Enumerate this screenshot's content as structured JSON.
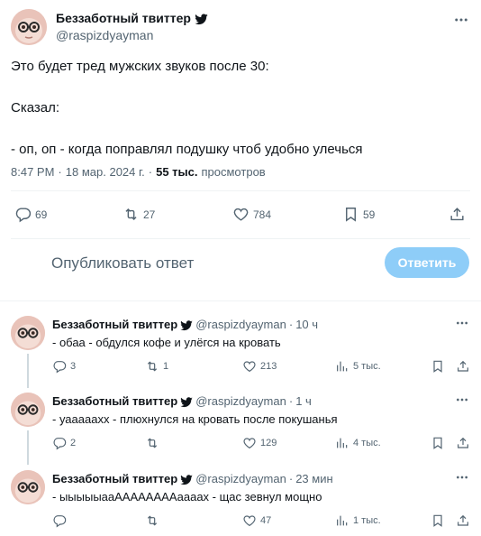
{
  "main_tweet": {
    "author_name": "Беззаботный твиттер",
    "handle": "@raspizdyayman",
    "text_lines": [
      "Это будет тред мужских звуков после 30:",
      "",
      "Сказал:",
      "",
      "- оп, оп - когда поправлял подушку чтоб удобно улечься"
    ],
    "time": "8:47 PM",
    "date": "18 мар. 2024 г.",
    "views_count": "55 тыс.",
    "views_label": "просмотров",
    "replies": "69",
    "retweets": "27",
    "likes": "784",
    "bookmarks": "59"
  },
  "composer": {
    "placeholder": "Опубликовать ответ",
    "submit_label": "Ответить"
  },
  "replies": [
    {
      "author_name": "Беззаботный твиттер",
      "handle": "@raspizdyayman",
      "time": "10 ч",
      "text": "- обаа - обдулся кофе и улёгся на кровать",
      "replies": "3",
      "retweets": "1",
      "likes": "213",
      "views": "5 тыс."
    },
    {
      "author_name": "Беззаботный твиттер",
      "handle": "@raspizdyayman",
      "time": "1 ч",
      "text": "- уаааааxx - плюхнулся на кровать после покушанья",
      "replies": "2",
      "retweets": "",
      "likes": "129",
      "views": "4 тыс."
    },
    {
      "author_name": "Беззаботный твиттер",
      "handle": "@raspizdyayman",
      "time": "23 мин",
      "text": "- ыыыыыааААААААААаааах - щас зевнул мощно",
      "replies": "",
      "retweets": "",
      "likes": "47",
      "views": "1 тыс."
    }
  ],
  "icons": {
    "verified": "verified-badge-icon",
    "reply": "reply-icon",
    "retweet": "retweet-icon",
    "like": "heart-icon",
    "bookmark": "bookmark-icon",
    "share": "share-icon",
    "views": "views-icon",
    "more": "more-icon"
  },
  "colors": {
    "text": "#0f1419",
    "secondary": "#536471",
    "reply_button": "#8ecdf8",
    "divider": "#eff3f4"
  }
}
